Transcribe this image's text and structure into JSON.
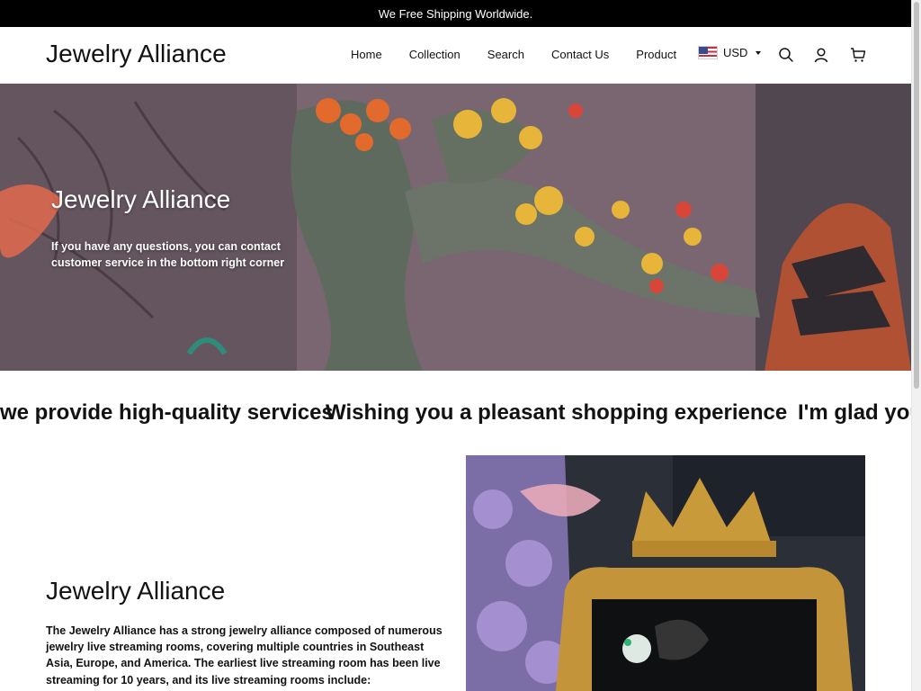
{
  "announcement": "We Free Shipping Worldwide.",
  "header": {
    "logo": "Jewelry Alliance",
    "nav": [
      "Home",
      "Collection",
      "Search",
      "Contact Us",
      "Product"
    ],
    "currency": "USD",
    "icons": [
      "us-flag-icon",
      "chevron-down-icon",
      "search-icon",
      "account-icon",
      "cart-icon"
    ]
  },
  "hero": {
    "title": "Jewelry Alliance",
    "text": "If you have any questions, you can contact customer service in the bottom right corner"
  },
  "marquee": {
    "items": [
      "we provide high-quality services",
      "Wishing you a pleasant shopping experience",
      "I'm glad you"
    ]
  },
  "about": {
    "title": "Jewelry Alliance",
    "text": "The Jewelry Alliance has a strong jewelry alliance composed of numerous jewelry live streaming rooms, covering multiple countries in Southeast Asia, Europe, and America. The earliest live streaming room has been live streaming for 10 years, and its live streaming rooms include:"
  },
  "colors": {
    "announcement_bg": "#000000",
    "text": "#121212",
    "background": "#ffffff"
  }
}
